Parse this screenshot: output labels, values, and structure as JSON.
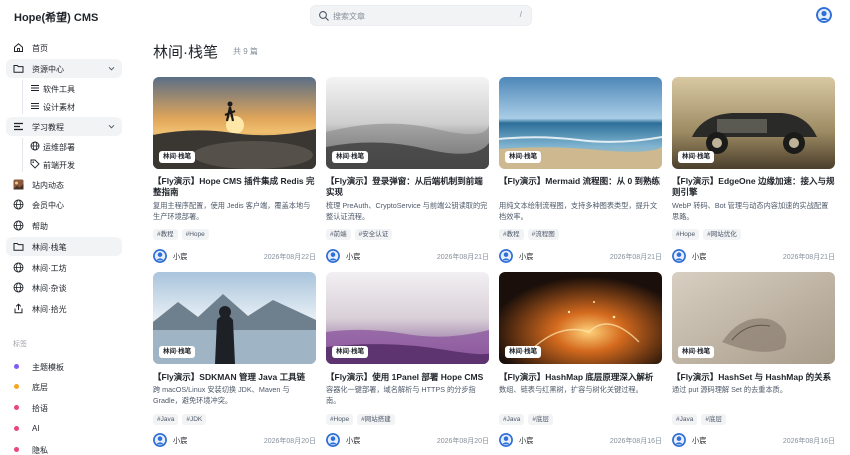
{
  "header": {
    "logo": "Hope(希望) CMS",
    "search_placeholder": "搜索文章",
    "search_shortcut": "/"
  },
  "sidebar": {
    "items": [
      {
        "label": "首页",
        "icon": "home-icon"
      },
      {
        "label": "资源中心",
        "icon": "folder-icon"
      },
      {
        "label": "软件工具",
        "icon": "list-icon"
      },
      {
        "label": "设计素材",
        "icon": "list-icon"
      },
      {
        "label": "学习教程",
        "icon": "menu-icon"
      },
      {
        "label": "运维部署",
        "icon": "globe-icon"
      },
      {
        "label": "前端开发",
        "icon": "tag-icon"
      },
      {
        "label": "站内动态",
        "icon": "image-icon"
      },
      {
        "label": "会员中心",
        "icon": "globe-icon"
      },
      {
        "label": "帮助",
        "icon": "globe-icon"
      },
      {
        "label": "林间·栈笔",
        "icon": "folder-icon"
      },
      {
        "label": "林间·工坊",
        "icon": "globe-icon"
      },
      {
        "label": "林间·杂谈",
        "icon": "globe-icon"
      },
      {
        "label": "林间·拾光",
        "icon": "share-icon"
      }
    ],
    "tags_label": "标签",
    "tags": [
      {
        "label": "主题模板",
        "color": "#7c5cf5"
      },
      {
        "label": "底层",
        "color": "#f5a623"
      },
      {
        "label": "拾语",
        "color": "#e8477a"
      },
      {
        "label": "AI",
        "color": "#e8477a"
      },
      {
        "label": "隐私",
        "color": "#e8477a"
      }
    ]
  },
  "main": {
    "title": "林间·栈笔",
    "count": "共 9 篇"
  },
  "cards": [
    {
      "category": "林间·栈笔",
      "title": "【Fly演示】Hope CMS 插件集成 Redis 完整指南",
      "desc": "复用主程序配置，使用 Jedis 客户端，覆盖本地与生产环境部署。",
      "tags": [
        "#教程",
        "#Hope"
      ],
      "author": "小宸",
      "date": "2026年08月22日"
    },
    {
      "category": "林间·栈笔",
      "title": "【Fly演示】登录弹窗：从后端机制到前端实现",
      "desc": "梳理 PreAuth、CryptoService 与前端公钥读取的完整认证流程。",
      "tags": [
        "#前端",
        "#安全认证"
      ],
      "author": "小宸",
      "date": "2026年08月21日"
    },
    {
      "category": "林间·栈笔",
      "title": "【Fly演示】Mermaid 流程图：从 0 到熟练",
      "desc": "用纯文本绘制流程图，支持多种图表类型，提升文档效率。",
      "tags": [
        "#教程",
        "#流程图"
      ],
      "author": "小宸",
      "date": "2026年08月21日"
    },
    {
      "category": "林间·栈笔",
      "title": "【Fly演示】EdgeOne 边缘加速：接入与规则引擎",
      "desc": "WebP 转码、Bot 管理与动态内容加速的实战配置思路。",
      "tags": [
        "#Hope",
        "#网站优化"
      ],
      "author": "小宸",
      "date": "2026年08月21日"
    },
    {
      "category": "林间·栈笔",
      "title": "【Fly演示】SDKMAN 管理 Java 工具链",
      "desc": "跨 macOS/Linux 安装切换 JDK、Maven 与 Gradle，避免环境冲突。",
      "tags": [
        "#Java",
        "#JDK"
      ],
      "author": "小宸",
      "date": "2026年08月20日"
    },
    {
      "category": "林间·栈笔",
      "title": "【Fly演示】使用 1Panel 部署 Hope CMS",
      "desc": "容器化一键部署，域名解析与 HTTPS 的分步指南。",
      "tags": [
        "#Hope",
        "#网站搭建"
      ],
      "author": "小宸",
      "date": "2026年08月20日"
    },
    {
      "category": "林间·栈笔",
      "title": "【Fly演示】HashMap 底层原理深入解析",
      "desc": "数组、链表与红黑树，扩容与树化关键过程。",
      "tags": [
        "#Java",
        "#底层"
      ],
      "author": "小宸",
      "date": "2026年08月16日"
    },
    {
      "category": "林间·栈笔",
      "title": "【Fly演示】HashSet 与 HashMap 的关系",
      "desc": "通过 put 源码理解 Set 的去重本质。",
      "tags": [
        "#Java",
        "#底层"
      ],
      "author": "小宸",
      "date": "2026年08月16日"
    }
  ],
  "colors": {
    "accent": "#1f2329",
    "muted": "#86909c",
    "active_bg": "#f2f3f5"
  }
}
